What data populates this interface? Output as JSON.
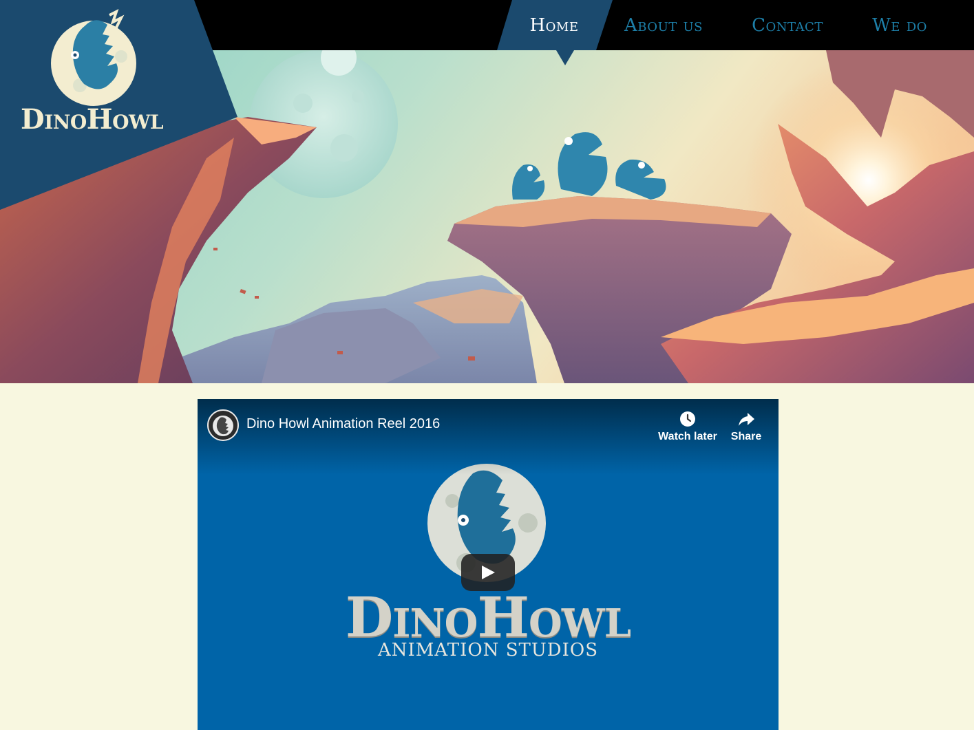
{
  "brand": {
    "name": "DinoHowl",
    "logo_icon": "dino-moon-logo-icon"
  },
  "nav": {
    "items": [
      {
        "label": "Home",
        "active": true
      },
      {
        "label": "About us",
        "active": false
      },
      {
        "label": "Contact",
        "active": false
      },
      {
        "label": "We do",
        "active": false
      }
    ]
  },
  "hero": {
    "description_icon": "hero-illustration"
  },
  "video": {
    "title": "Dino Howl Animation Reel 2016",
    "watch_later_label": "Watch later",
    "share_label": "Share",
    "watch_later_icon": "clock-icon",
    "share_icon": "share-arrow-icon",
    "play_icon": "play-icon",
    "thumbnail": {
      "brand_name": "DinoHowl",
      "subtitle": "ANIMATION STUDIOS"
    }
  },
  "colors": {
    "nav_bg": "#000000",
    "nav_link": "#1d7fa8",
    "nav_active_bg": "#1b4a6e",
    "page_bg": "#f8f7e0",
    "video_bg": "#0064a8",
    "logo_panel": "#1b4a6e"
  }
}
